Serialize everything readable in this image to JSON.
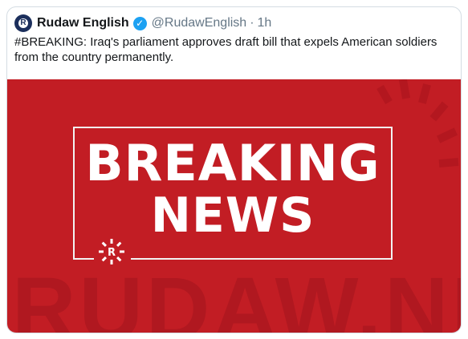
{
  "tweet": {
    "author_name": "Rudaw English",
    "handle": "@RudawEnglish",
    "separator": "·",
    "time": "1h",
    "text": "#BREAKING: Iraq's parliament approves draft bill that expels American soldiers from the country permanently.",
    "avatar_letter": "R",
    "verified_glyph": "✓"
  },
  "card": {
    "headline_line1": "BREAKING",
    "headline_line2": "NEWS",
    "watermark": "RUDAW.NET",
    "logo_letter": "R",
    "background_color": "#c21d24"
  }
}
